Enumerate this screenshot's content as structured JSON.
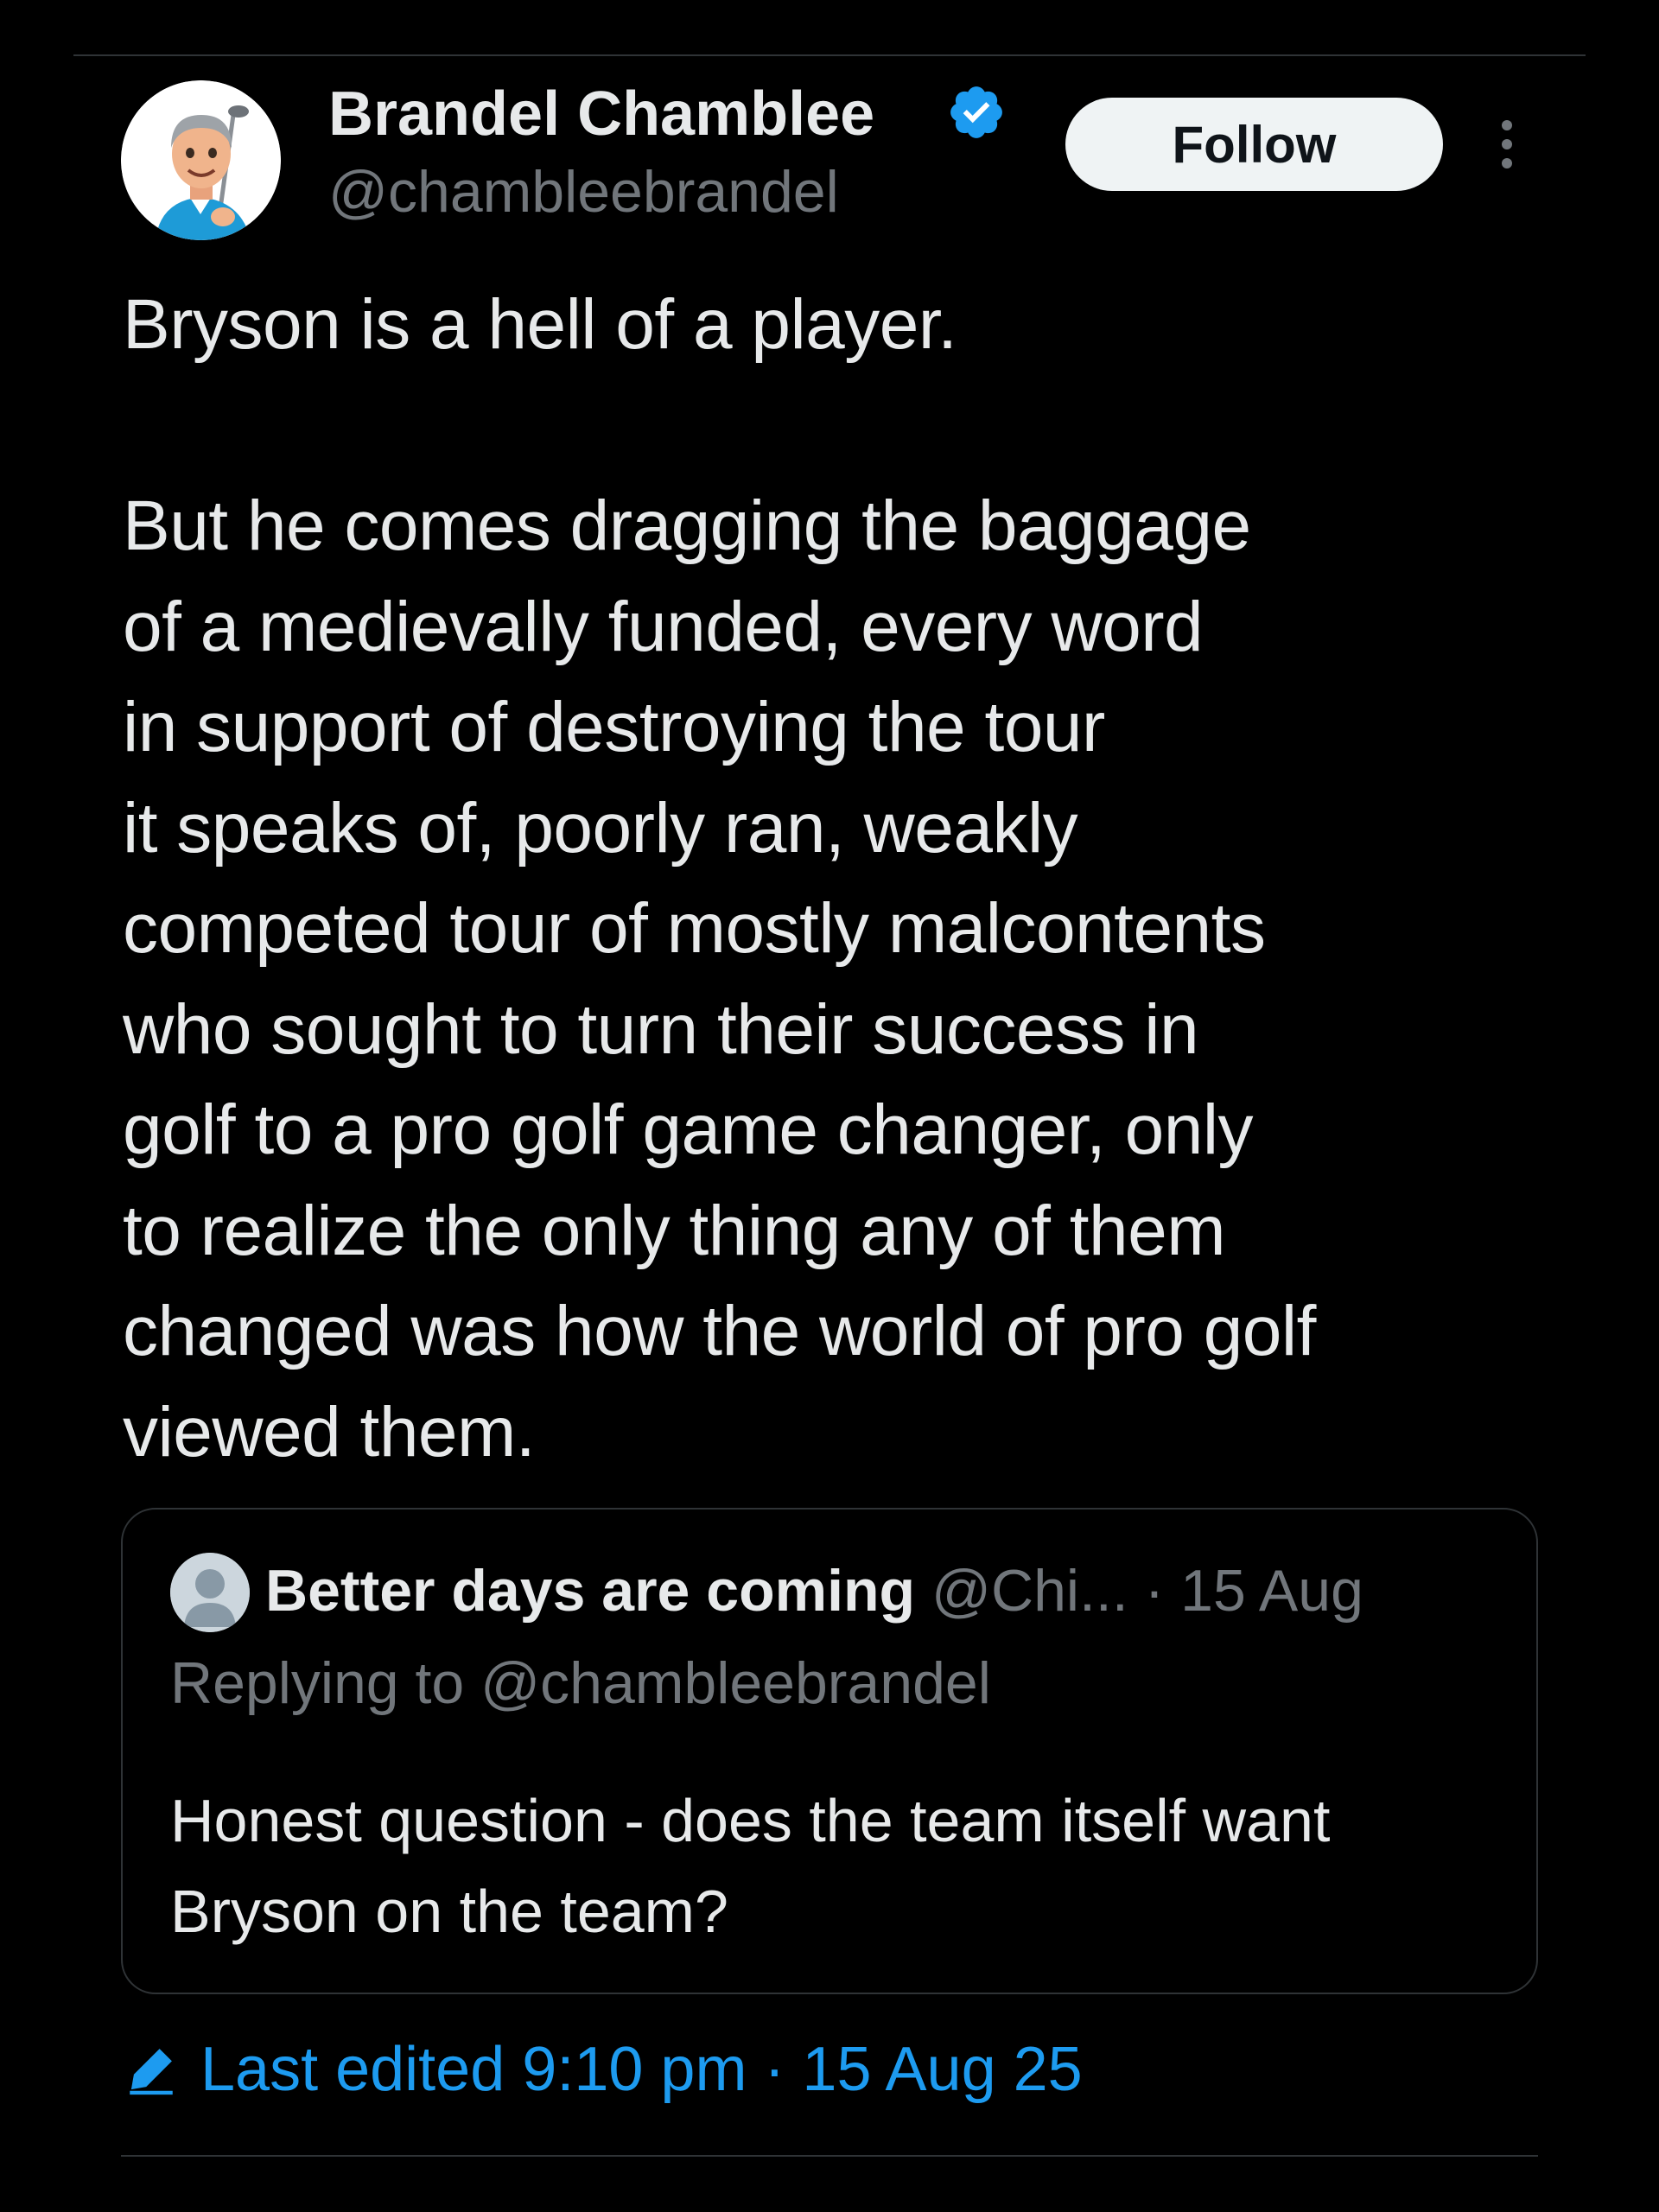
{
  "author": {
    "name": "Brandel Chamblee",
    "handle": "@chambleebrandel",
    "verified": true,
    "avatar_icon": "memoji-golfer-avatar"
  },
  "actions": {
    "follow_label": "Follow",
    "more_icon": "vertical-dots-icon"
  },
  "tweet": {
    "text": "Bryson is a hell of a player.\n\nBut he comes dragging the baggage\nof a medievally funded, every word\nin support of destroying the tour\nit speaks of, poorly ran, weakly\ncompeted tour of mostly malcontents\nwho sought to turn their success in\ngolf to a pro golf game changer, only\nto realize the only thing any of them\nchanged was how the world of pro golf\nviewed them."
  },
  "quoted_tweet": {
    "name": "Better days are coming",
    "handle": "@Chi...",
    "date": "15 Aug",
    "separator": " · ",
    "replying_to": "Replying to @chambleebrandel",
    "text": "Honest question - does the team itself want Bryson on the team?"
  },
  "edited": {
    "label": "Last edited 9:10 pm · 15 Aug 25",
    "icon": "pencil-icon"
  },
  "colors": {
    "background": "#000000",
    "text": "#e7e9ea",
    "secondary": "#71767b",
    "accent": "#1d9bf0",
    "divider": "#2f3336"
  }
}
